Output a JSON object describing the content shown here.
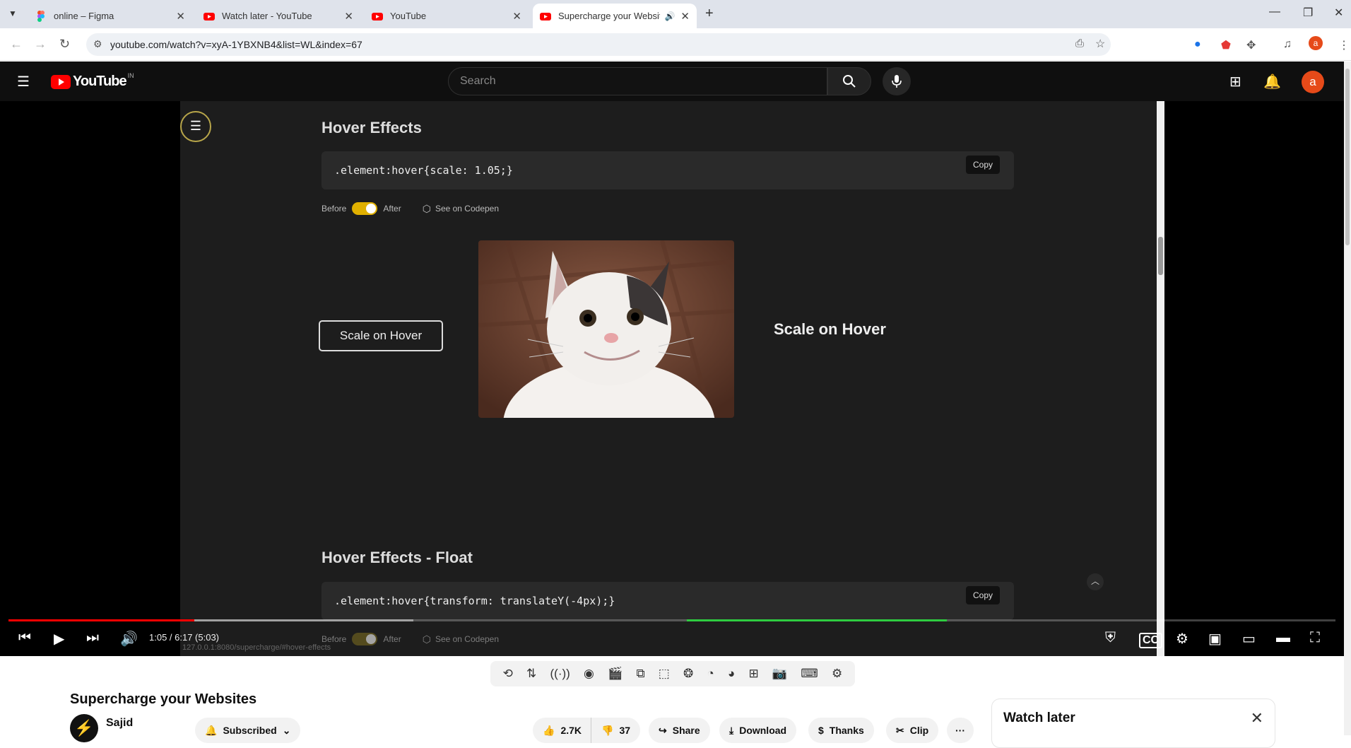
{
  "browser": {
    "tabs": [
      {
        "title": "online – Figma",
        "icon": "figma-icon"
      },
      {
        "title": "Watch later - YouTube",
        "icon": "youtube-icon"
      },
      {
        "title": "YouTube",
        "icon": "youtube-icon"
      },
      {
        "title": "Supercharge your Websites",
        "icon": "youtube-icon",
        "active": true
      }
    ],
    "url": "youtube.com/watch?v=xyA-1YBXNB4&list=WL&index=67"
  },
  "youtube": {
    "logo_text": "YouTube",
    "region": "IN",
    "search_placeholder": "Search",
    "avatar_letter": "a"
  },
  "video_frame": {
    "section1": {
      "title": "Hover Effects",
      "code": ".element:hover{scale: 1.05;}",
      "copy_label": "Copy",
      "before_label": "Before",
      "after_label": "After",
      "codepen_label": "See on Codepen",
      "demo_button": "Scale on Hover",
      "demo_label": "Scale on Hover"
    },
    "section2": {
      "title": "Hover Effects - Float",
      "code": ".element:hover{transform: translateY(-4px);}",
      "copy_label": "Copy",
      "before_label": "Before",
      "after_label": "After",
      "codepen_label": "See on Codepen"
    },
    "status_url": "127.0.0.1:8080/supercharge/#hover-effects"
  },
  "player": {
    "time": "1:05 / 6:17 (5:03)",
    "progress_played": 0.14,
    "progress_loaded": 0.305
  },
  "below": {
    "video_title": "Supercharge your Websites",
    "channel_name": "Sajid",
    "subscribed_label": "Subscribed",
    "likes": "2.7K",
    "dislikes": "37",
    "share_label": "Share",
    "download_label": "Download",
    "thanks_label": "Thanks",
    "clip_label": "Clip",
    "more_label": "···",
    "watch_later_title": "Watch later"
  }
}
